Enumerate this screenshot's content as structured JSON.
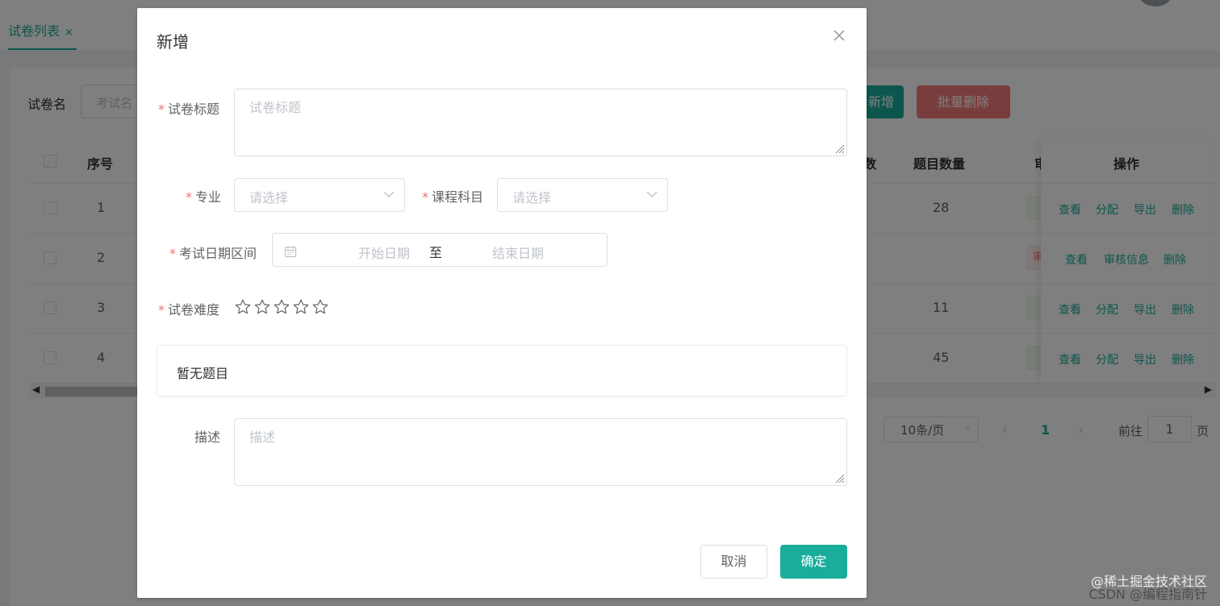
{
  "background": {
    "tab_label": "试卷列表",
    "tab_close": "×",
    "search_label": "试卷名",
    "search_placeholder": "考试名",
    "add_button": "新增",
    "batch_delete_button": "批量删除",
    "table": {
      "headers": {
        "index": "序号",
        "partial_count": "数",
        "question_count": "题目数量",
        "partial_review": "审",
        "actions": "操作"
      },
      "rows": [
        {
          "index": "1",
          "question_count": "28",
          "actions": [
            "查看",
            "分配",
            "导出",
            "删除"
          ]
        },
        {
          "index": "2",
          "question_count": "",
          "status": "审",
          "actions": [
            "查看",
            "审核信息",
            "删除"
          ]
        },
        {
          "index": "3",
          "question_count": "11",
          "actions": [
            "查看",
            "分配",
            "导出",
            "删除"
          ]
        },
        {
          "index": "4",
          "question_count": "45",
          "actions": [
            "查看",
            "分配",
            "导出",
            "删除"
          ]
        }
      ]
    },
    "pagination": {
      "page_size": "10条/页",
      "prev": "‹",
      "current_page": "1",
      "next": "›",
      "goto_label": "前往",
      "goto_value": "1",
      "page_suffix": "页"
    }
  },
  "dialog": {
    "title": "新增",
    "close_icon": "close-icon",
    "fields": {
      "title": {
        "label": "试卷标题",
        "placeholder": "试卷标题",
        "required": "*"
      },
      "major": {
        "label": "专业",
        "placeholder": "请选择",
        "required": "*"
      },
      "course": {
        "label": "课程科目",
        "placeholder": "请选择",
        "required": "*"
      },
      "date_range": {
        "label": "考试日期区间",
        "start_placeholder": "开始日期",
        "separator": "至",
        "end_placeholder": "结束日期",
        "required": "*"
      },
      "difficulty": {
        "label": "试卷难度",
        "required": "*",
        "rating": 0,
        "max": 5
      },
      "description": {
        "label": "描述",
        "placeholder": "描述"
      }
    },
    "questions_empty_text": "暂无题目",
    "cancel_button": "取消",
    "confirm_button": "确定"
  },
  "watermark": {
    "line1": "@稀土掘金技术社区",
    "line2": "CSDN @编程指南针"
  },
  "colors": {
    "primary": "#1aad9b",
    "danger": "#f56c6c",
    "required": "#f56c6c",
    "border": "#dcdfe6",
    "placeholder": "#c0c4cc"
  }
}
